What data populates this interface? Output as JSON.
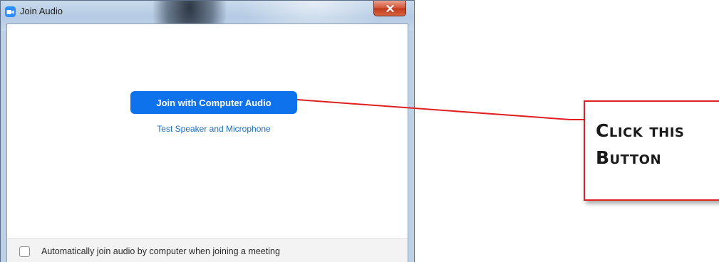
{
  "window": {
    "title": "Join Audio",
    "icon": "zoom-camera-icon",
    "close_icon": "close-icon"
  },
  "main": {
    "join_button_label": "Join with Computer Audio",
    "test_link_label": "Test Speaker and Microphone"
  },
  "footer": {
    "auto_join_label": "Automatically join audio by computer when joining a meeting",
    "auto_join_checked": false
  },
  "annotation": {
    "callout_line1": "Click this",
    "callout_line2": "Button",
    "accent_color": "#e02020"
  },
  "colors": {
    "primary_button": "#0e72ed",
    "link": "#1a6ec2",
    "zoom_brand": "#2d8cff"
  }
}
